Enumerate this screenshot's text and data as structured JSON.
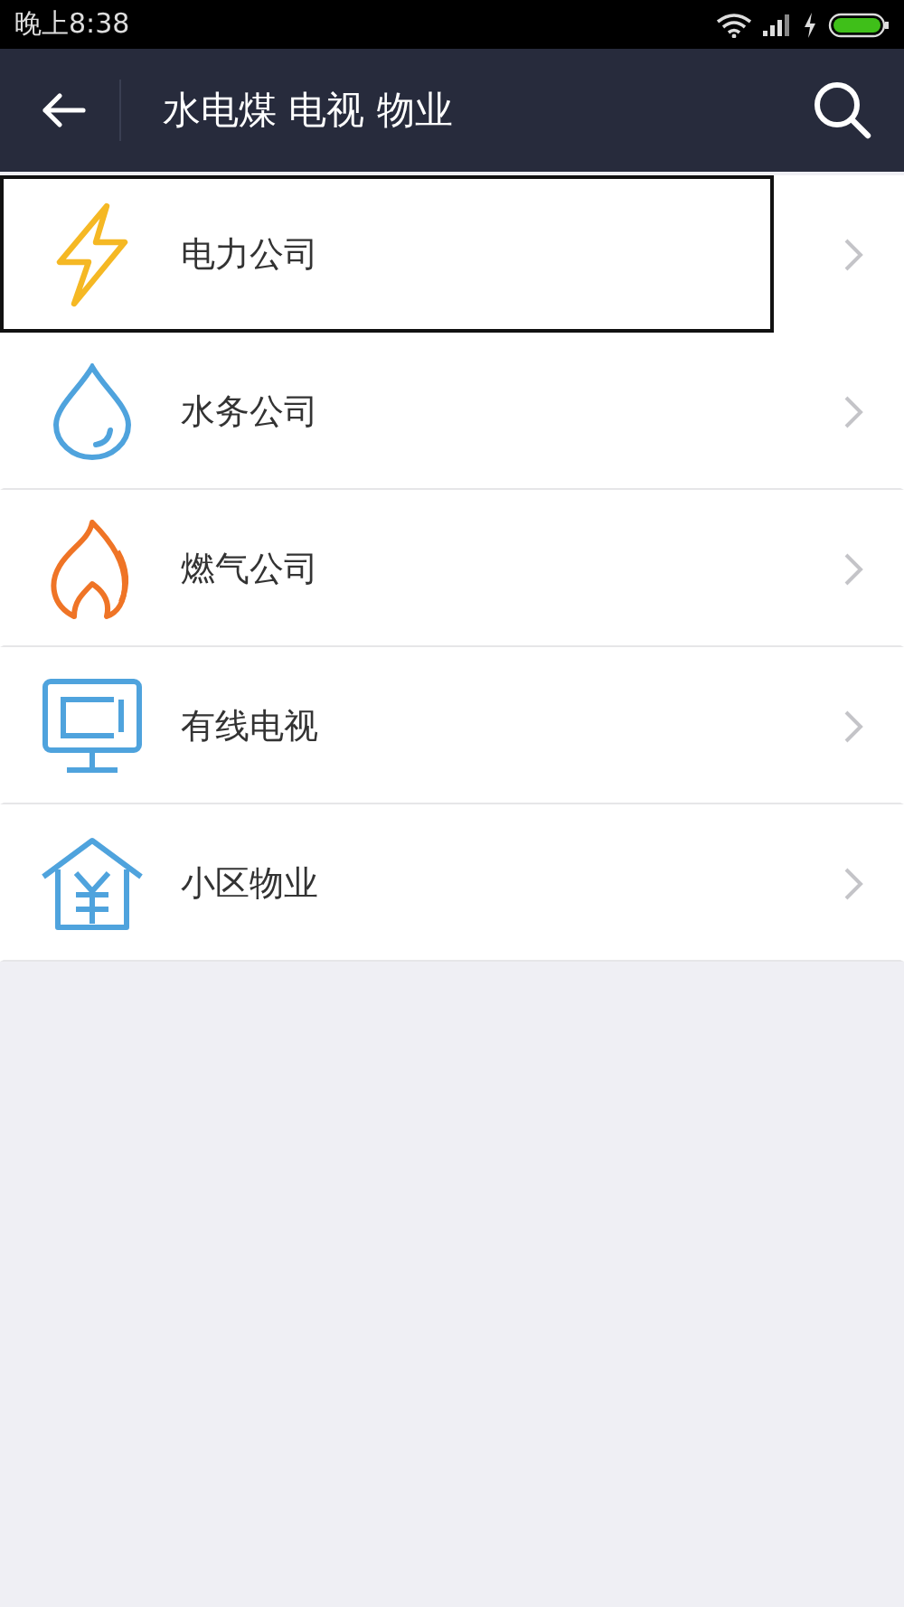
{
  "status_bar": {
    "time": "晚上8:38"
  },
  "header": {
    "title": "水电煤 电视 物业"
  },
  "items": [
    {
      "kind": "electricity",
      "label": "电力公司",
      "selected": true
    },
    {
      "kind": "water",
      "label": "水务公司",
      "selected": false
    },
    {
      "kind": "gas",
      "label": "燃气公司",
      "selected": false
    },
    {
      "kind": "tv",
      "label": "有线电视",
      "selected": false
    },
    {
      "kind": "property",
      "label": "小区物业",
      "selected": false
    }
  ]
}
